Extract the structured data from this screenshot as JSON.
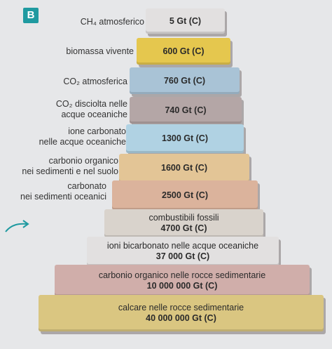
{
  "badge": "B",
  "colors": {
    "yellow": "#e5c74e",
    "blue": "#a9c3d6",
    "mauve": "#b4a6a6",
    "lightblue": "#b0d2e3",
    "tan": "#e3c596",
    "pinktan": "#dbb39c",
    "grey": "#d9d3cc",
    "lightgrey": "#e2e0e0",
    "rose": "#d0aeaa",
    "gold": "#dac681"
  },
  "levels": [
    {
      "label": "CH₄ atmosferico",
      "value": "5 Gt (C)"
    },
    {
      "label": "biomassa vivente",
      "value": "600 Gt (C)"
    },
    {
      "label": "CO₂ atmosferica",
      "value": "760 Gt (C)"
    },
    {
      "label_line1": "CO₂ disciolta nelle",
      "label_line2": "acque oceaniche",
      "value": "740 Gt (C)"
    },
    {
      "label_line1": "ione carbonato",
      "label_line2": "nelle acque oceaniche",
      "value": "1300 Gt (C)"
    },
    {
      "label_line1": "carbonio organico",
      "label_line2": "nei sedimenti e nel suolo",
      "value": "1600 Gt (C)"
    },
    {
      "label_line1": "carbonato",
      "label_line2": "nei sedimenti oceanici",
      "value": "2500 Gt (C)"
    },
    {
      "name": "combustibili fossili",
      "value": "4700 Gt (C)"
    },
    {
      "name": "ioni bicarbonato nelle acque oceaniche",
      "value": "37 000 Gt (C)"
    },
    {
      "name": "carbonio organico nelle rocce sedimentarie",
      "value": "10 000 000 Gt (C)"
    },
    {
      "name": "calcare nelle rocce sedimentarie",
      "value": "40 000 000 Gt (C)"
    }
  ]
}
